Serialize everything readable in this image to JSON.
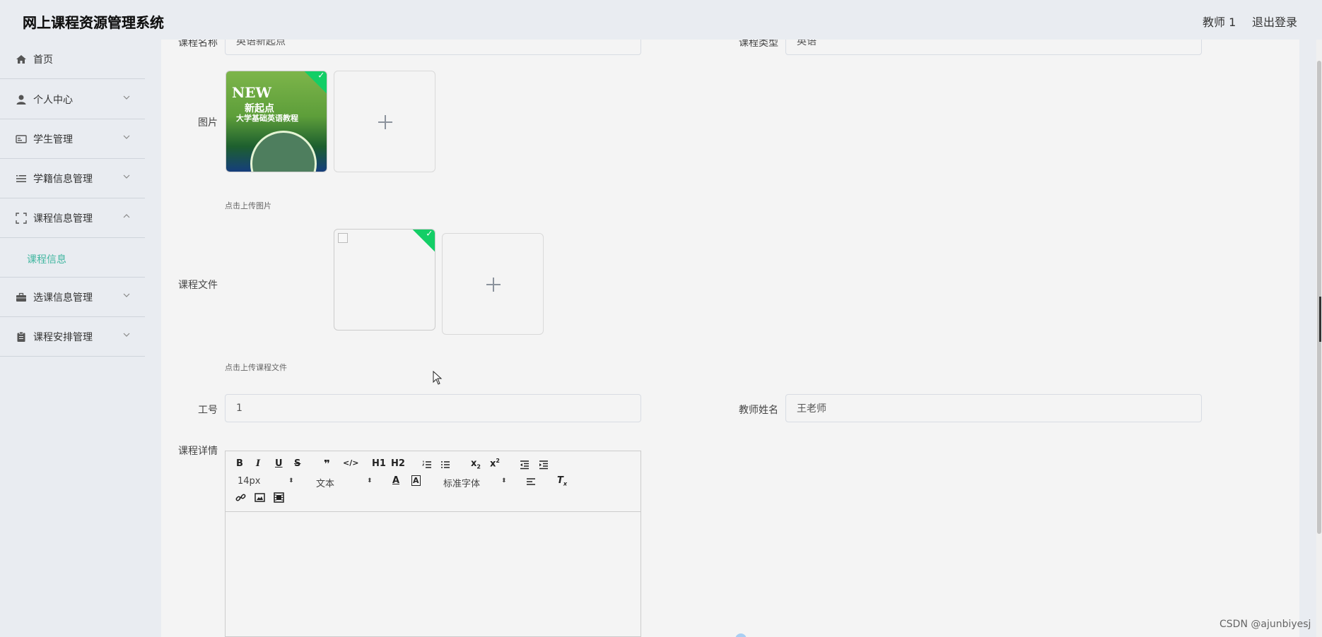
{
  "header": {
    "title": "网上课程资源管理系统",
    "user": "教师 1",
    "logout": "退出登录"
  },
  "sidebar": {
    "items": [
      {
        "label": "首页",
        "icon": "home-icon"
      },
      {
        "label": "个人中心",
        "icon": "user-icon"
      },
      {
        "label": "学生管理",
        "icon": "id-card-icon"
      },
      {
        "label": "学籍信息管理",
        "icon": "list-icon"
      },
      {
        "label": "课程信息管理",
        "icon": "fullscreen-icon"
      },
      {
        "label": "选课信息管理",
        "icon": "briefcase-icon"
      },
      {
        "label": "课程安排管理",
        "icon": "clipboard-icon"
      }
    ],
    "submenu_item": "课程信息"
  },
  "form": {
    "course_name_label": "课程名称",
    "course_name_value": "英语新起点",
    "course_type_label": "课程类型",
    "course_type_value": "英语",
    "image_label": "图片",
    "image_hint": "点击上传图片",
    "file_label": "课程文件",
    "file_hint": "点击上传课程文件",
    "job_no_label": "工号",
    "job_no_value": "1",
    "teacher_label": "教师姓名",
    "teacher_value": "王老师",
    "detail_label": "课程详情"
  },
  "cover": {
    "line1": "NEW",
    "line2": "新起点",
    "line3": "大学基础英语教程"
  },
  "editor": {
    "font_size": "14px",
    "header": "文本",
    "font_family": "标准字体",
    "buttons": {
      "h1": "H1",
      "h2": "H2"
    }
  },
  "watermark": "CSDN @ajunbiyesj",
  "colors": {
    "accent": "#41b6a0",
    "success": "#13ce66",
    "background": "#e9ecf1",
    "content": "#f4f4f4"
  }
}
